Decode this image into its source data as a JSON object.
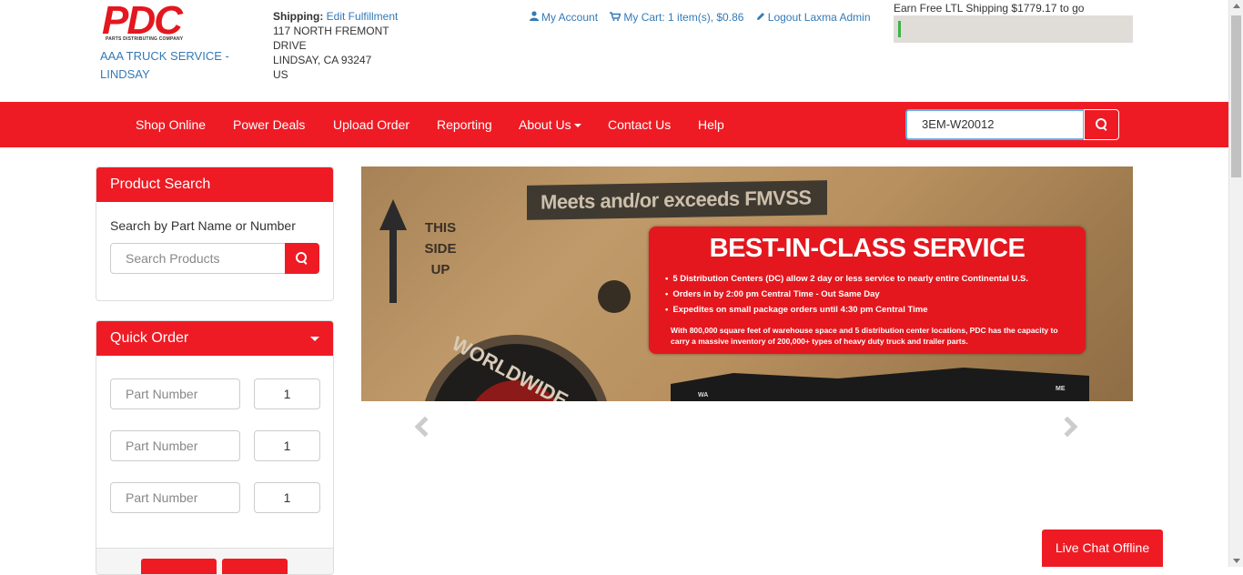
{
  "header": {
    "logo_text": "PDC",
    "logo_sub": "PARTS DISTRIBUTING COMPANY",
    "company_name": "AAA TRUCK SERVICE - LINDSAY",
    "shipping": {
      "label": "Shipping:",
      "edit_link": "Edit Fulfillment",
      "address_lines": [
        "117 NORTH FREMONT",
        "DRIVE",
        "LINDSAY, CA 93247",
        "US"
      ]
    },
    "account_links": {
      "my_account": "My Account",
      "my_cart": "My Cart: 1 item(s), $0.86",
      "logout": "Logout Laxma Admin"
    },
    "ltl": {
      "text": "Earn Free LTL Shipping $1779.17 to go",
      "progress_fraction": 0.01,
      "fill_color": "#3cb34a"
    }
  },
  "nav": {
    "items": [
      "Shop Online",
      "Power Deals",
      "Upload Order",
      "Reporting",
      "About Us",
      "Contact Us",
      "Help"
    ],
    "search_value": "3EM-W20012",
    "accent_color": "#ee1b24"
  },
  "product_search": {
    "title": "Product Search",
    "label": "Search by Part Name or Number",
    "placeholder": "Search Products"
  },
  "quick_order": {
    "title": "Quick Order",
    "rows": [
      {
        "part_placeholder": "Part Number",
        "qty": "1"
      },
      {
        "part_placeholder": "Part Number",
        "qty": "1"
      },
      {
        "part_placeholder": "Part Number",
        "qty": "1"
      }
    ]
  },
  "banner": {
    "meets_text": "Meets and/or exceeds FMVSS",
    "this_side_up": [
      "THIS",
      "SIDE",
      "UP"
    ],
    "badge_text": "WORLDWIDE",
    "title": "BEST-IN-CLASS SERVICE",
    "bullets": [
      "5 Distribution Centers (DC) allow 2 day or less service to nearly entire Continental U.S.",
      "Orders in by 2:00 pm Central Time - Out Same Day",
      "Expedites on small package orders until 4:30 pm Central Time"
    ],
    "description": "With 800,000 square feet of warehouse space and 5 distribution center locations, PDC has the capacity to carry a massive inventory of 200,000+ types of heavy duty truck and trailer parts.",
    "map_labels": [
      "WA",
      "ME"
    ]
  },
  "live_chat": "Live Chat Offline",
  "icons": [
    "user-icon",
    "cart-icon",
    "pencil-icon",
    "search-icon",
    "chevron-left-icon",
    "chevron-right-icon",
    "caret-down-icon"
  ]
}
